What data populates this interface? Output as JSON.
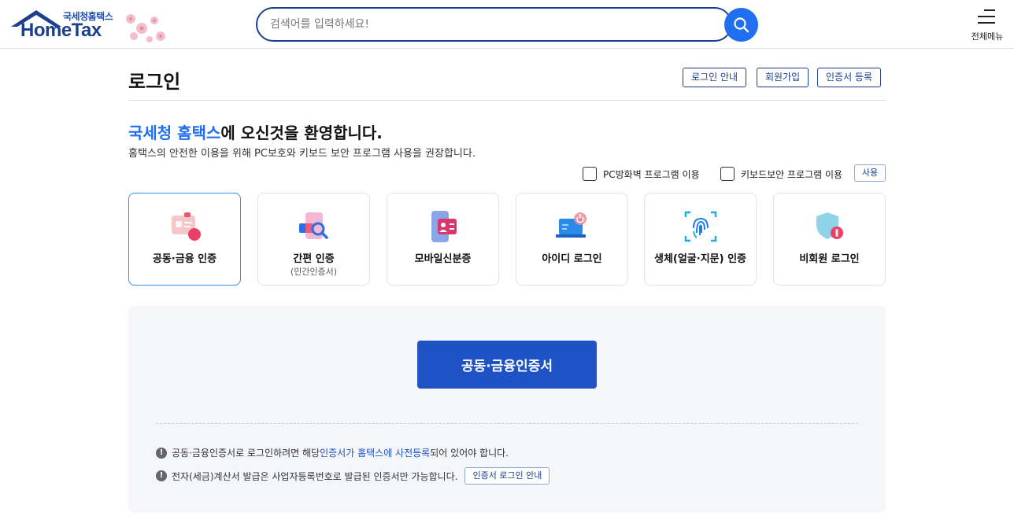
{
  "header": {
    "logo_sub": "국세청홈택스",
    "logo_main": "HomeTax",
    "search_placeholder": "검색어를 입력하세요!",
    "menu_label": "전체메뉴"
  },
  "title_row": {
    "title": "로그인",
    "links": [
      "로그인 안내",
      "회원가입",
      "인증서 등록"
    ]
  },
  "welcome": {
    "highlight": "국세청 홈택스",
    "rest": "에 오신것을 환영합니다.",
    "sub": "홈택스의 안전한 이용을 위해 PC보호와 키보드 보안 프로그램 사용을 권장합니다."
  },
  "options": {
    "firewall": "PC방화벽 프로그램 이용",
    "keyboard": "키보드보안 프로그램 이용",
    "use_button": "사용"
  },
  "methods": [
    {
      "name": "공동·금융 인증",
      "sub": "",
      "icon": "cert-card-icon",
      "active": true
    },
    {
      "name": "간편 인증",
      "sub": "(민간인증서)",
      "icon": "simple-auth-icon",
      "active": false
    },
    {
      "name": "모바일신분증",
      "sub": "",
      "icon": "mobile-id-icon",
      "active": false
    },
    {
      "name": "아이디 로그인",
      "sub": "",
      "icon": "laptop-login-icon",
      "active": false
    },
    {
      "name": "생체(얼굴·지문) 인증",
      "sub": "",
      "icon": "fingerprint-icon",
      "active": false
    },
    {
      "name": "비회원 로그인",
      "sub": "",
      "icon": "shield-icon",
      "active": false
    }
  ],
  "panel": {
    "cert_button": "공동·금융인증서",
    "note1_before": "공동·금융인증서로 로그인하려면 해당 ",
    "note1_link": "인증서가 홈택스에 사전등록",
    "note1_after": "되어 있어야 합니다.",
    "note2": "전자(세금)계산서 발급은 사업자등록번호로 발급된 인증서만 가능합니다.",
    "guide_button": "인증서 로그인 안내"
  },
  "colors": {
    "primary": "#1f52c4",
    "accent": "#1f6ff0",
    "navy": "#1d3f8f",
    "panel_bg": "#f4f6f9"
  }
}
